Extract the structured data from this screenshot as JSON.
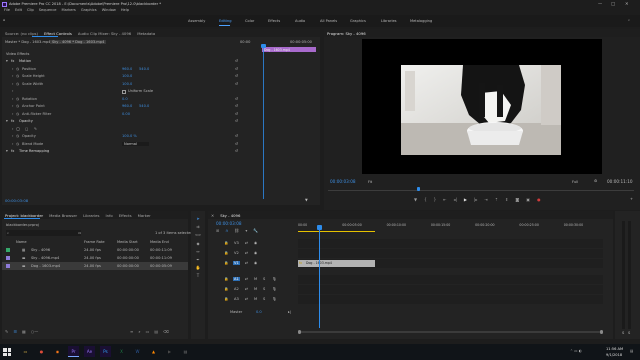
{
  "window": {
    "title": "Adobe Premiere Pro CC 2018 - E:\\Documents\\Adobe\\Premiere Pro\\12.0\\blackborder *",
    "controls": [
      "—",
      "□",
      "✕"
    ]
  },
  "menu": [
    "File",
    "Edit",
    "Clip",
    "Sequence",
    "Markers",
    "Graphics",
    "Window",
    "Help"
  ],
  "workspaces": [
    "Assembly",
    "Editing",
    "Color",
    "Effects",
    "Audio",
    "All Panels",
    "Graphics",
    "Libraries",
    "Metalogging"
  ],
  "active_workspace": "Editing",
  "source_panel": {
    "tabs": [
      "Source: (no clips)",
      "Effect Controls",
      "Audio Clip Mixer: Sky - 4096",
      "Metadata"
    ],
    "breadcrumb_master": "Master * Dog - 1603.mp4",
    "breadcrumb_seq": "Sky - 4096 * Dog - 1603.mp4",
    "video_effects_label": "Video Effects",
    "clip_label": "Dog - 1603.mp4",
    "ruler_start": "00:00",
    "ruler_end": "00:00:05:00",
    "effects": [
      {
        "name": "Motion",
        "level": 0
      },
      {
        "name": "Position",
        "level": 1,
        "v1": "960.0",
        "v2": "540.0"
      },
      {
        "name": "Scale Height",
        "level": 1,
        "v1": "100.0",
        "v2": ""
      },
      {
        "name": "Scale Width",
        "level": 1,
        "v1": "100.0",
        "v2": ""
      },
      {
        "name": "",
        "level": 1,
        "v1": "",
        "v2": "",
        "checkbox": "Uniform Scale"
      },
      {
        "name": "Rotation",
        "level": 1,
        "v1": "0.0",
        "v2": ""
      },
      {
        "name": "Anchor Point",
        "level": 1,
        "v1": "960.0",
        "v2": "540.0"
      },
      {
        "name": "Anti-flicker Filter",
        "level": 1,
        "v1": "0.00",
        "v2": ""
      },
      {
        "name": "Opacity",
        "level": 0
      },
      {
        "name": "",
        "level": 1,
        "v1": "",
        "v2": "",
        "masks": true
      },
      {
        "name": "Opacity",
        "level": 1,
        "v1": "100.0 %",
        "v2": ""
      },
      {
        "name": "Blend Mode",
        "level": 1,
        "v1": "Normal",
        "v2": ""
      },
      {
        "name": "Time Remapping",
        "level": 0
      }
    ],
    "timecode": "00:00:03:08"
  },
  "program": {
    "title": "Program: Sky - 4096",
    "timecode": "00:00:03:08",
    "fit": "Fit",
    "quality": "Full",
    "duration": "00:00:11:10",
    "playhead_fraction": 0.29
  },
  "project": {
    "tabs": [
      "Project: blackborder",
      "Media Browser",
      "Libraries",
      "Info",
      "Effects",
      "Marker"
    ],
    "file": "blackborder.prproj",
    "selected_count": "1 of 3 items selected",
    "columns": [
      "Name",
      "Frame Rate",
      "Media Start",
      "Media End"
    ],
    "items": [
      {
        "name": "Sky - 4096",
        "rate": "24.00 fps",
        "start": "00:00:00:00",
        "end": "00:00:11:09",
        "color": "#35a86b"
      },
      {
        "name": "Sky - 4096.mp4",
        "rate": "24.00 fps",
        "start": "00:00:00:00",
        "end": "00:00:11:09",
        "color": "#8e7bd8"
      },
      {
        "name": "Dog - 1603.mp4",
        "rate": "24.00 fps",
        "start": "00:00:00:00",
        "end": "00:00:05:09",
        "color": "#8e7bd8"
      }
    ]
  },
  "timeline": {
    "sequence": "Sky - 4096",
    "timecode": "00:00:03:08",
    "ruler": [
      "00:00",
      "00:00:05:00",
      "00:00:10:00",
      "00:00:15:00",
      "00:00:20:00",
      "00:00:25:00",
      "00:00:30:00"
    ],
    "video_tracks": [
      "V3",
      "V2",
      "V1"
    ],
    "audio_tracks": [
      "A1",
      "A2",
      "A3"
    ],
    "master": "Master",
    "master_value": "0.0",
    "clip_label": "Dog - 1603.mp4"
  },
  "taskbar": {
    "time": "11:56 AM",
    "date": "9/1/2018",
    "apps": [
      "explorer",
      "chrome",
      "firefox",
      "premiere",
      "after-effects",
      "photoshop",
      "excel",
      "word",
      "vlc",
      "media",
      "files"
    ]
  },
  "colors": {
    "accent": "#2d8ceb",
    "timecode": "#3d8ee0",
    "clip": "#b3b3b3",
    "selected_clip": "#a86acc"
  }
}
